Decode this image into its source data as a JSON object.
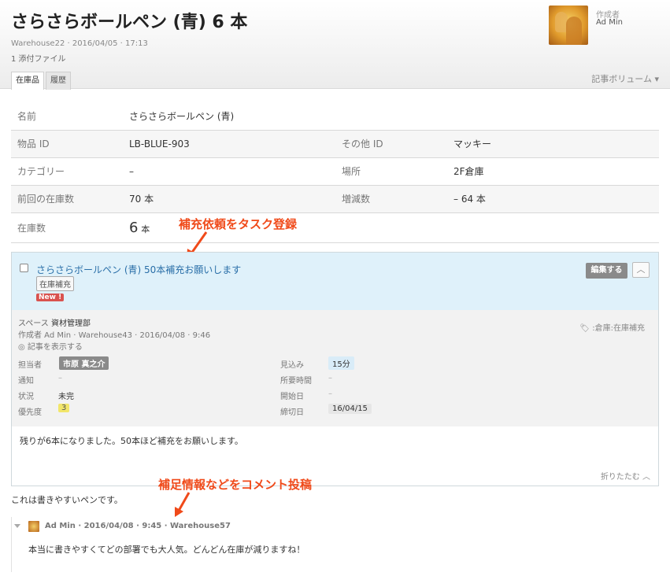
{
  "article": {
    "title": "さらさらボールペン (青) 6 本",
    "meta": "Warehouse22 · 2016/04/05 · 17:13",
    "attachments": "1 添付ファイル",
    "author_label": "作成者",
    "author_name": "Ad Min"
  },
  "tabs": [
    {
      "label": "在庫品",
      "active": true
    },
    {
      "label": "履歴",
      "active": false
    }
  ],
  "volume_label": "記事ボリューム ▾",
  "properties": {
    "name_label": "名前",
    "name_value": "さらさらボールペン (青)",
    "id_label": "物品 ID",
    "id_value": "LB-BLUE-903",
    "other_id_label": "その他 ID",
    "other_id_value": "マッキー",
    "category_label": "カテゴリー",
    "category_value": "–",
    "location_label": "場所",
    "location_value": "2F倉庫",
    "prev_label": "前回の在庫数",
    "prev_value": "70 本",
    "delta_label": "増減数",
    "delta_value": "– 64 本",
    "stock_label": "在庫数",
    "stock_number": "6",
    "stock_unit": "本"
  },
  "annotations": {
    "task_note": "補充依頼をタスク登録",
    "comment_note": "補足情報などをコメント投稿",
    "color": "#f04a1a"
  },
  "task": {
    "title": "さらさらボールペン (青) 50本補充お願いします",
    "tag": "在庫補充",
    "new_badge": "New !",
    "edit_label": "編集する",
    "collapse_icon": "︿",
    "space_label": "スペース",
    "space_value": "資材管理部",
    "creator": "作成者 Ad Min · Warehouse43 · 2016/04/08 · 9:46",
    "view_link": "◎ 記事を表示する",
    "tags": "🏷 :倉庫:在庫補充",
    "fields": {
      "assignee_label": "担当者",
      "assignee_value": "市原 真之介",
      "notify_label": "通知",
      "notify_value": "–",
      "status_label": "状況",
      "status_value": "未完",
      "priority_label": "優先度",
      "priority_value": "3",
      "estimate_label": "見込み",
      "estimate_value": "15分",
      "time_label": "所要時間",
      "time_value": "–",
      "start_label": "開始日",
      "start_value": "–",
      "due_label": "締切日",
      "due_value": "16/04/15"
    },
    "body": "残りが6本になりました。50本ほど補充をお願いします。",
    "fold_label": "折りたたむ ︿"
  },
  "comment": {
    "text": "これは書きやすいペンです。",
    "reply_meta": "Ad Min · 2016/04/08 · 9:45 · Warehouse57",
    "reply_text": "本当に書きやすくてどの部署でも大人気。どんどん在庫が減りますね！"
  }
}
